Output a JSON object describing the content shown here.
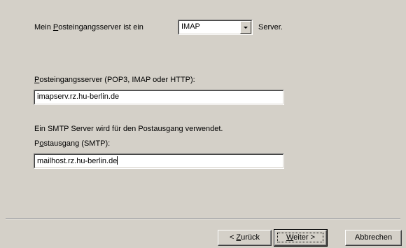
{
  "server_type": {
    "label_prefix": "Mein ",
    "label_access": "P",
    "label_rest": "osteingangsserver ist ein",
    "selected": "IMAP",
    "suffix": "Server."
  },
  "incoming": {
    "label_access": "P",
    "label_rest": "osteingangsserver (POP3, IMAP oder HTTP):",
    "value": "imapserv.rz.hu-berlin.de"
  },
  "smtp_note": "Ein SMTP Server wird für den Postausgang verwendet.",
  "outgoing": {
    "label_first": "P",
    "label_access": "o",
    "label_rest": "stausgang (SMTP):",
    "value": "mailhost.rz.hu-berlin.de"
  },
  "buttons": {
    "back_prefix": "< ",
    "back_access": "Z",
    "back_rest": "urück",
    "next_access": "W",
    "next_rest": "eiter >",
    "cancel": "Abbrechen"
  }
}
